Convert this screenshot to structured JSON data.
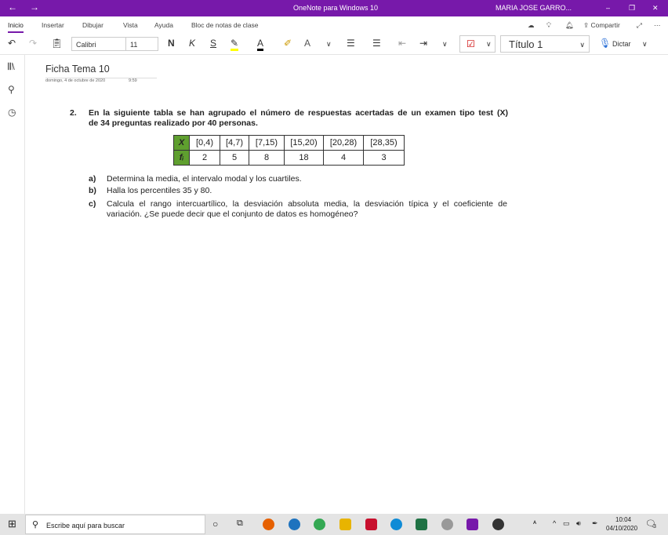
{
  "titlebar": {
    "title": "OneNote para Windows 10",
    "user": "MARIA JOSE GARRO..."
  },
  "tabs": [
    "Inicio",
    "Insertar",
    "Dibujar",
    "Vista",
    "Ayuda",
    "Bloc de notas de clase"
  ],
  "share": "Compartir",
  "toolbar": {
    "font": "Calibri",
    "size": "11",
    "bold": "N",
    "italic": "K",
    "underline": "S",
    "font_color": "A",
    "style": "Título 1",
    "dictate": "Dictar"
  },
  "page": {
    "title": "Ficha Tema 10",
    "date": "domingo, 4 de octubre de 2020",
    "time": "9:59"
  },
  "question": {
    "number": "2.",
    "text1": "En la siguiente tabla se han agrupado el número de respuestas acertadas de un examen tipo test (X)",
    "text2": "de 34 preguntas realizado por 40 personas."
  },
  "table": {
    "header_x": "X",
    "header_f": "fᵢ",
    "intervals": [
      "[0,4)",
      "[4,7)",
      "[7,15)",
      "[15,20)",
      "[20,28)",
      "[28,35)"
    ],
    "freqs": [
      "2",
      "5",
      "8",
      "18",
      "4",
      "3"
    ]
  },
  "items": [
    {
      "label": "a)",
      "text": "Determina la media, el intervalo modal y los cuartiles."
    },
    {
      "label": "b)",
      "text": "Halla los percentiles 35 y 80."
    },
    {
      "label": "c)",
      "text": "Calcula el rango intercuartílico, la desviación absoluta media, la desviación típica y el coeficiente de",
      "text2": "variación. ¿Se puede decir que el conjunto de datos es homogéneo?"
    }
  ],
  "taskbar": {
    "search": "Escribe aquí para buscar",
    "time": "10:04",
    "date": "04/10/2020",
    "notif": "3"
  }
}
